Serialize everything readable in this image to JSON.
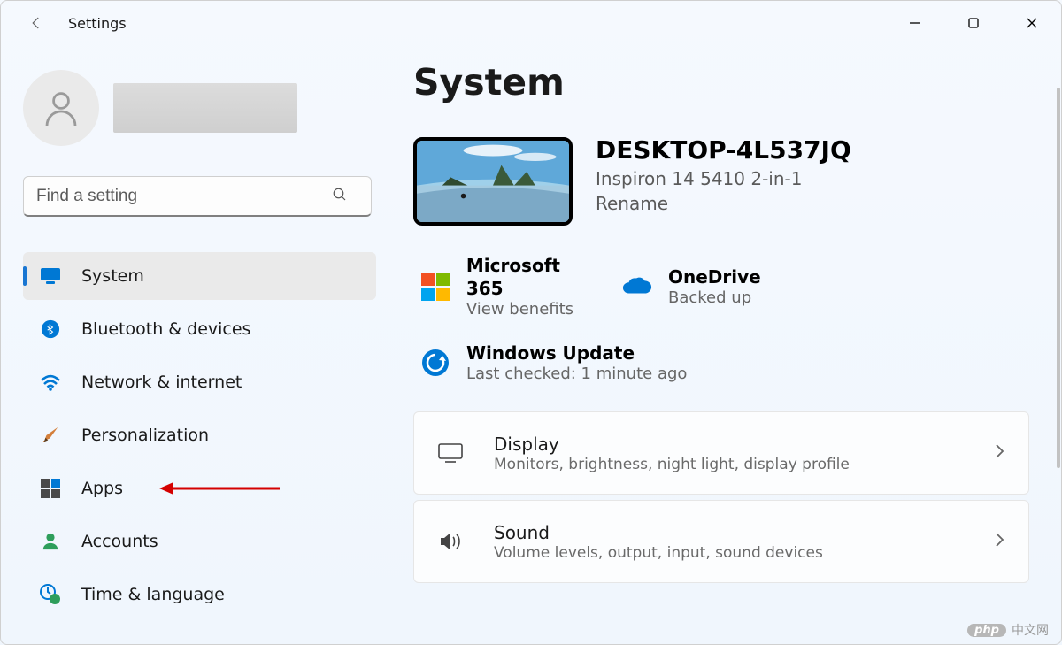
{
  "app_title": "Settings",
  "search": {
    "placeholder": "Find a setting"
  },
  "sidebar": {
    "items": [
      {
        "label": "System",
        "icon": "monitor-icon",
        "selected": true
      },
      {
        "label": "Bluetooth & devices",
        "icon": "bluetooth-icon"
      },
      {
        "label": "Network & internet",
        "icon": "wifi-icon"
      },
      {
        "label": "Personalization",
        "icon": "brush-icon"
      },
      {
        "label": "Apps",
        "icon": "apps-icon"
      },
      {
        "label": "Accounts",
        "icon": "person-icon"
      },
      {
        "label": "Time & language",
        "icon": "clock-globe-icon"
      }
    ]
  },
  "page": {
    "title": "System",
    "pc_name": "DESKTOP-4L537JQ",
    "pc_model": "Inspiron 14 5410 2-in-1",
    "rename_label": "Rename"
  },
  "tiles": {
    "m365": {
      "title": "Microsoft 365",
      "sub": "View benefits"
    },
    "onedrive": {
      "title": "OneDrive",
      "sub": "Backed up"
    },
    "update": {
      "title": "Windows Update",
      "sub": "Last checked: 1 minute ago"
    }
  },
  "cards": [
    {
      "title": "Display",
      "sub": "Monitors, brightness, night light, display profile",
      "icon": "display-icon"
    },
    {
      "title": "Sound",
      "sub": "Volume levels, output, input, sound devices",
      "icon": "sound-icon"
    }
  ],
  "watermark": {
    "badge": "php",
    "text": "中文网"
  }
}
